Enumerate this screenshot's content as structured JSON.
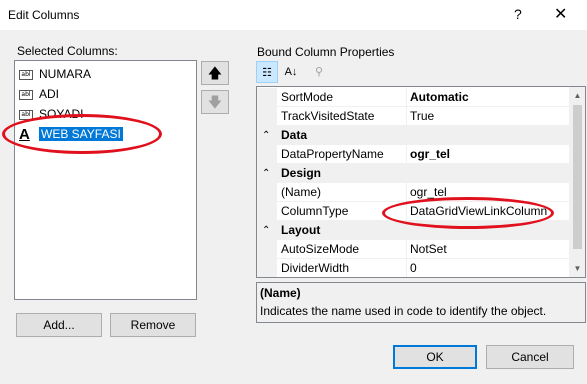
{
  "window": {
    "title": "Edit Columns",
    "help_glyph": "?",
    "close_glyph": "✕"
  },
  "left": {
    "selected_columns_label": "Selected Columns:",
    "columns": [
      {
        "icon": "abl",
        "label": "NUMARA"
      },
      {
        "icon": "abl",
        "label": "ADI"
      },
      {
        "icon": "abl",
        "label": "SOYADI"
      },
      {
        "icon": "link",
        "label": "WEB SAYFASI",
        "selected": true
      }
    ],
    "move_up_glyph": "🡅",
    "move_down_glyph": "🡇",
    "add_label": "Add...",
    "remove_label": "Remove"
  },
  "right": {
    "properties_label": "Bound Column Properties",
    "toolbar": {
      "categorized_glyph": "☷",
      "alphabetical_glyph": "A↓",
      "property_pages_glyph": "⚲"
    },
    "grid": {
      "rows": [
        {
          "kind": "prop",
          "name": "SortMode",
          "value": "Automatic",
          "bold": true
        },
        {
          "kind": "prop",
          "name": "TrackVisitedState",
          "value": "True",
          "bold": false
        },
        {
          "kind": "cat",
          "name": "Data"
        },
        {
          "kind": "prop",
          "name": "DataPropertyName",
          "value": "ogr_tel",
          "bold": true
        },
        {
          "kind": "cat",
          "name": "Design"
        },
        {
          "kind": "prop",
          "name": "(Name)",
          "value": "ogr_tel",
          "bold": false
        },
        {
          "kind": "prop",
          "name": "ColumnType",
          "value": "DataGridViewLinkColumn",
          "bold": false
        },
        {
          "kind": "cat",
          "name": "Layout"
        },
        {
          "kind": "prop",
          "name": "AutoSizeMode",
          "value": "NotSet",
          "bold": false
        },
        {
          "kind": "prop",
          "name": "DividerWidth",
          "value": "0",
          "bold": false
        }
      ],
      "collapse_glyph": "⌃"
    },
    "description": {
      "title": "(Name)",
      "text": "Indicates the name used in code to identify the object."
    }
  },
  "footer": {
    "ok_label": "OK",
    "cancel_label": "Cancel"
  },
  "colors": {
    "selection": "#0078d7",
    "annotation_red": "#e0101c",
    "dialog_bg": "#f0f0f0"
  }
}
